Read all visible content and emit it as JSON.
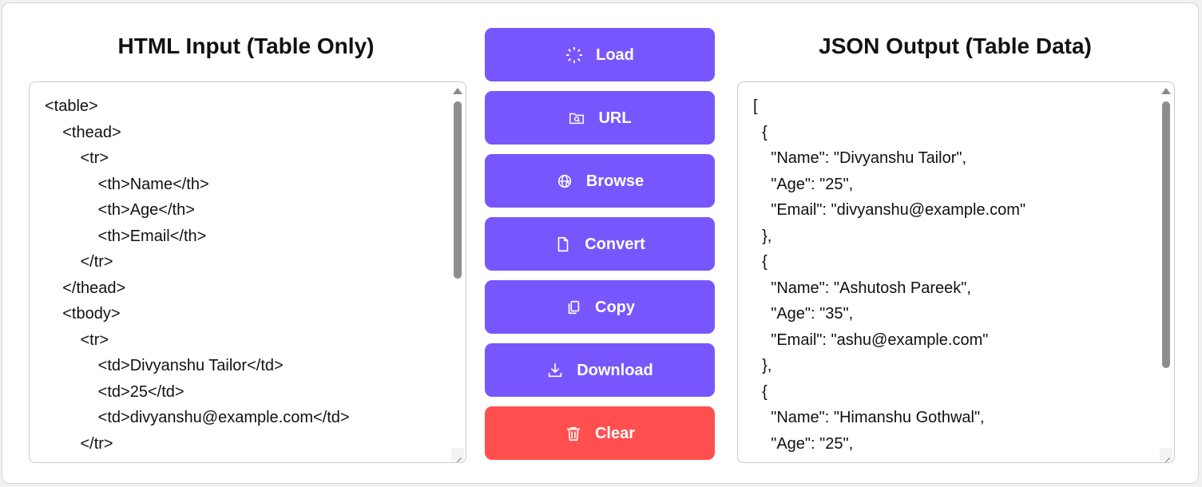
{
  "input_panel": {
    "title": "HTML Input (Table Only)",
    "content": "<table>\n    <thead>\n        <tr>\n            <th>Name</th>\n            <th>Age</th>\n            <th>Email</th>\n        </tr>\n    </thead>\n    <tbody>\n        <tr>\n            <td>Divyanshu Tailor</td>\n            <td>25</td>\n            <td>divyanshu@example.com</td>\n        </tr>"
  },
  "output_panel": {
    "title": "JSON Output (Table Data)",
    "content": "[\n  {\n    \"Name\": \"Divyanshu Tailor\",\n    \"Age\": \"25\",\n    \"Email\": \"divyanshu@example.com\"\n  },\n  {\n    \"Name\": \"Ashutosh Pareek\",\n    \"Age\": \"35\",\n    \"Email\": \"ashu@example.com\"\n  },\n  {\n    \"Name\": \"Himanshu Gothwal\",\n    \"Age\": \"25\","
  },
  "buttons": {
    "load": {
      "label": "Load",
      "icon": "loader-icon"
    },
    "url": {
      "label": "URL",
      "icon": "folder-search-icon"
    },
    "browse": {
      "label": "Browse",
      "icon": "globe-icon"
    },
    "convert": {
      "label": "Convert",
      "icon": "file-icon"
    },
    "copy": {
      "label": "Copy",
      "icon": "copy-icon"
    },
    "download": {
      "label": "Download",
      "icon": "download-icon"
    },
    "clear": {
      "label": "Clear",
      "icon": "trash-icon"
    }
  },
  "colors": {
    "primary_button": "#7757fd",
    "danger_button": "#ff4f4f",
    "text": "#111111",
    "background": "#ffffff"
  }
}
